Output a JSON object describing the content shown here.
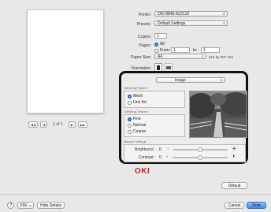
{
  "preview": {
    "page_indicator": "1 of 1"
  },
  "print_settings": {
    "printer_label": "Printer:",
    "printer_value": "OKI-8840-A23132",
    "presets_label": "Presets:",
    "presets_value": "Default Settings",
    "copies_label": "Copies:",
    "copies_value": "1",
    "pages_label": "Pages:",
    "pages_all": "All",
    "pages_from_label": "From:",
    "pages_from_value": "1",
    "pages_to_label": "to:",
    "pages_to_value": "1",
    "paper_size_label": "Paper Size:",
    "paper_size_value": "A4",
    "paper_size_dims": "210 by 297 mm",
    "orientation_label": "Orientation:"
  },
  "image_panel": {
    "dropdown_value": "Image",
    "dithering_pattern_title": "Dithering Pattern",
    "dithering_pattern_options": [
      "Mesh",
      "Line Art"
    ],
    "dithering_pattern_selected": 0,
    "dithering_texture_title": "Dithering Texture",
    "dithering_texture_options": [
      "Fine",
      "Normal",
      "Coarse"
    ],
    "dithering_texture_selected": 0,
    "manual_settings_title": "Manual Settings",
    "brightness_label": "Brightness:",
    "brightness_value": "0",
    "brightness_level": 0.5,
    "contrast_label": "Contrast:",
    "contrast_value": "0",
    "contrast_level": 0.5
  },
  "brand_logo": "OKI",
  "buttons": {
    "default": "Default",
    "help": "?",
    "pdf": "PDF",
    "hide_details": "Hide Details",
    "cancel": "Cancel",
    "print": "Print"
  },
  "colors": {
    "accent": "#2b6fd6",
    "brand": "#d41e1e",
    "highlight_border": "#111111"
  }
}
